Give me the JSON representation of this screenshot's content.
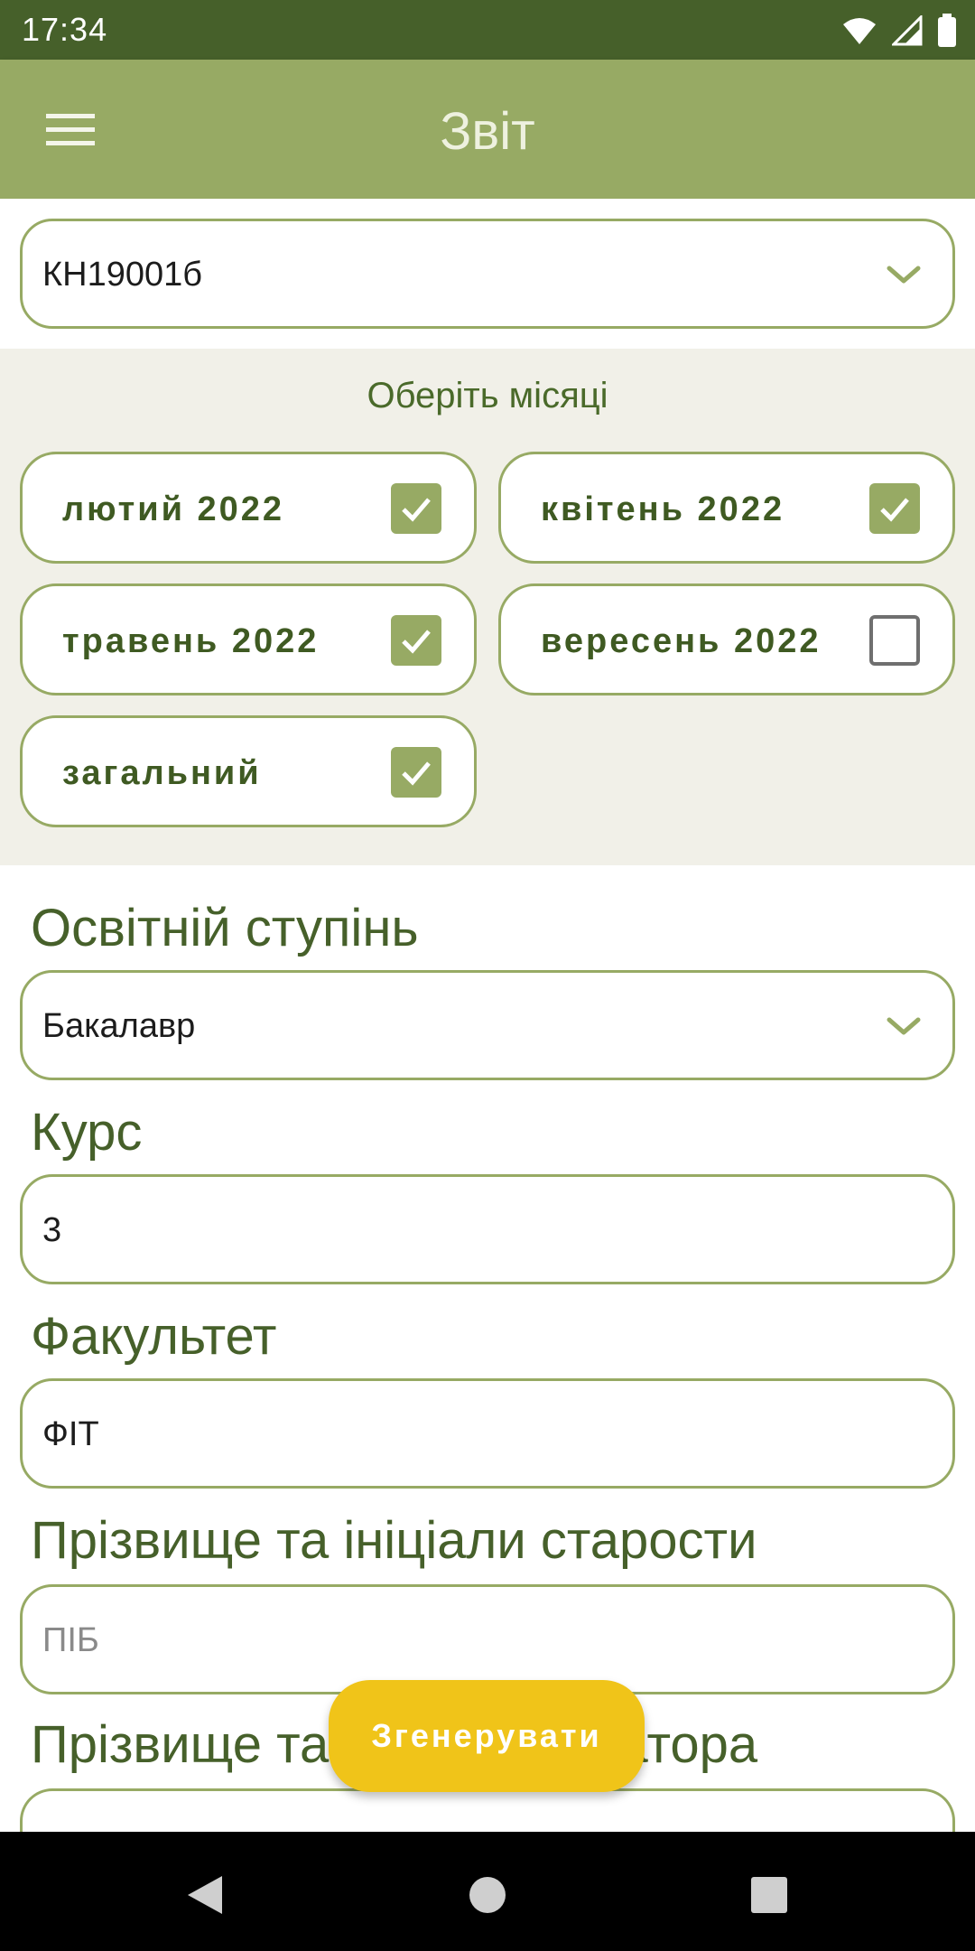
{
  "status_bar": {
    "time": "17:34",
    "icons": [
      "wifi-icon",
      "signal-icon",
      "battery-icon"
    ]
  },
  "app_bar": {
    "title": "Звіт",
    "menu_icon": "hamburger-menu-icon"
  },
  "group_select": {
    "value": "КН19001б"
  },
  "months": {
    "title": "Оберіть місяці",
    "items": [
      {
        "label": "лютий 2022",
        "checked": true
      },
      {
        "label": "квітень 2022",
        "checked": true
      },
      {
        "label": "травень 2022",
        "checked": true
      },
      {
        "label": "вересень 2022",
        "checked": false
      },
      {
        "label": "загальний",
        "checked": true
      }
    ]
  },
  "form": {
    "degree": {
      "label": "Освітній ступінь",
      "value": "Бакалавр"
    },
    "course": {
      "label": "Курс",
      "value": "3"
    },
    "faculty": {
      "label": "Факультет",
      "value": "ФІТ"
    },
    "head_name": {
      "label": "Прізвище та ініціали старости",
      "placeholder": "ПІБ"
    },
    "curator_name": {
      "label": "Прізвище та ініціали куратора"
    }
  },
  "generate_button": {
    "label": "Згенерувати"
  },
  "colors": {
    "primary": "#97aa64",
    "dark": "#46602a",
    "accent": "#f0c419",
    "background": "#f1f0e8"
  }
}
